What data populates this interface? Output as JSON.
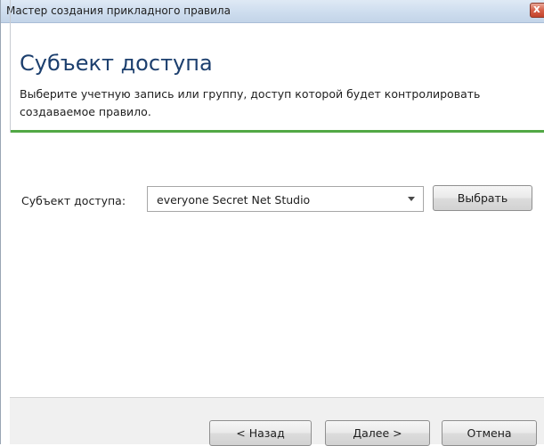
{
  "window": {
    "title": "Мастер создания прикладного правила",
    "close_glyph": "x"
  },
  "header": {
    "title": "Субъект доступа",
    "description": "Выберите учетную запись или группу, доступ которой будет контролировать создаваемое правило."
  },
  "form": {
    "subject_label": "Субъект доступа:",
    "subject_value": "everyone Secret Net Studio",
    "select_button": "Выбрать"
  },
  "footer": {
    "back_button": "< Назад",
    "next_button": "Далее >",
    "cancel_button": "Отмена"
  },
  "colors": {
    "accent_rule": "#52a845",
    "title_text": "#1c3f6e"
  }
}
